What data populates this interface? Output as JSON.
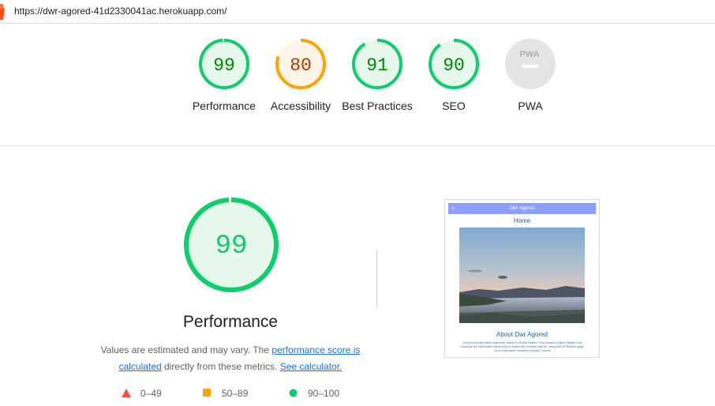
{
  "url": "https://dwr-agored-41d2330041ac.herokuapp.com/",
  "colors": {
    "pass": "#0cce6b",
    "pass_fill": "#e6f7ec",
    "pass_text": "#008800",
    "average": "#ffa400",
    "average_fill": "#fff6e8",
    "average_text": "#c33300",
    "pwa_fill": "#e4e4e4",
    "link": "#1a73e8",
    "fail": "#ff4e42"
  },
  "categories": [
    {
      "label": "Performance",
      "score": "99",
      "fraction": 0.99,
      "rating": "pass"
    },
    {
      "label": "Accessibility",
      "score": "80",
      "fraction": 0.8,
      "rating": "average"
    },
    {
      "label": "Best Practices",
      "score": "91",
      "fraction": 0.91,
      "rating": "pass"
    },
    {
      "label": "SEO",
      "score": "90",
      "fraction": 0.9,
      "rating": "pass"
    },
    {
      "label": "PWA",
      "score": "",
      "fraction": 0,
      "rating": "pwa",
      "badge": "PWA"
    }
  ],
  "performance": {
    "score": "99",
    "fraction": 0.99,
    "title": "Performance",
    "desc_prefix": "Values are estimated and may vary. The ",
    "link_score": "performance score is calculated",
    "desc_middle": " directly from these metrics. ",
    "link_calc": "See calculator."
  },
  "legend": [
    {
      "icon": "triangle-fail-icon",
      "range": "0–49"
    },
    {
      "icon": "square-average-icon",
      "range": "50–89"
    },
    {
      "icon": "circle-pass-icon",
      "range": "90–100"
    }
  ],
  "screenshot": {
    "nav_icon": "≡",
    "site_title": "Dwr Agored",
    "home": "Home",
    "about": "About Dwr Agored",
    "paragraph": "Are you a cold water swimmer based in South Wales? Dwr Agored (Open Water) is a resource for cold water swimmers to share and browse swims, using the All Swims page. As a cold water swimmer myself, I know"
  }
}
